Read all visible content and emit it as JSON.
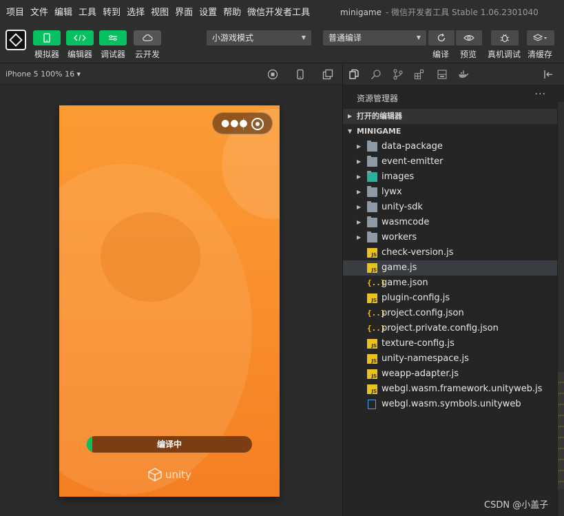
{
  "menubar": {
    "items": [
      "项目",
      "文件",
      "编辑",
      "工具",
      "转到",
      "选择",
      "视图",
      "界面",
      "设置",
      "帮助",
      "微信开发者工具"
    ],
    "app_name": "minigame",
    "window_title": "- 微信开发者工具 Stable 1.06.2301040"
  },
  "toolbar": {
    "simulator_label": "模拟器",
    "editor_label": "编辑器",
    "debugger_label": "调试器",
    "cloud_label": "云开发",
    "mode_select": "小游戏模式",
    "compile_select": "普通编译",
    "compile_label": "编译",
    "preview_label": "预览",
    "remote_debug_label": "真机调试",
    "clear_cache_label": "清缓存"
  },
  "device": {
    "label": "iPhone 5 100% 16 ▾"
  },
  "simulator": {
    "progress_text": "编译中",
    "progress_fraction": 0.035,
    "brand_text": "unity"
  },
  "explorer": {
    "title": "资源管理器",
    "more": "···",
    "open_editors": "打开的编辑器",
    "project": "MINIGAME",
    "folders": [
      "data-package",
      "event-emitter",
      "images",
      "lywx",
      "unity-sdk",
      "wasmcode",
      "workers"
    ],
    "files": [
      {
        "name": "check-version.js",
        "type": "js"
      },
      {
        "name": "game.js",
        "type": "js",
        "selected": true
      },
      {
        "name": "game.json",
        "type": "json"
      },
      {
        "name": "plugin-config.js",
        "type": "js"
      },
      {
        "name": "project.config.json",
        "type": "json"
      },
      {
        "name": "project.private.config.json",
        "type": "json"
      },
      {
        "name": "texture-config.js",
        "type": "js"
      },
      {
        "name": "unity-namespace.js",
        "type": "js"
      },
      {
        "name": "weapp-adapter.js",
        "type": "js"
      },
      {
        "name": "webgl.wasm.framework.unityweb.js",
        "type": "js"
      },
      {
        "name": "webgl.wasm.symbols.unityweb",
        "type": "file"
      }
    ]
  },
  "watermark": "CSDN @小盖子",
  "colors": {
    "accent_green": "#07c160",
    "phone_orange": "#fb9b34",
    "panel_bg": "#252526"
  }
}
